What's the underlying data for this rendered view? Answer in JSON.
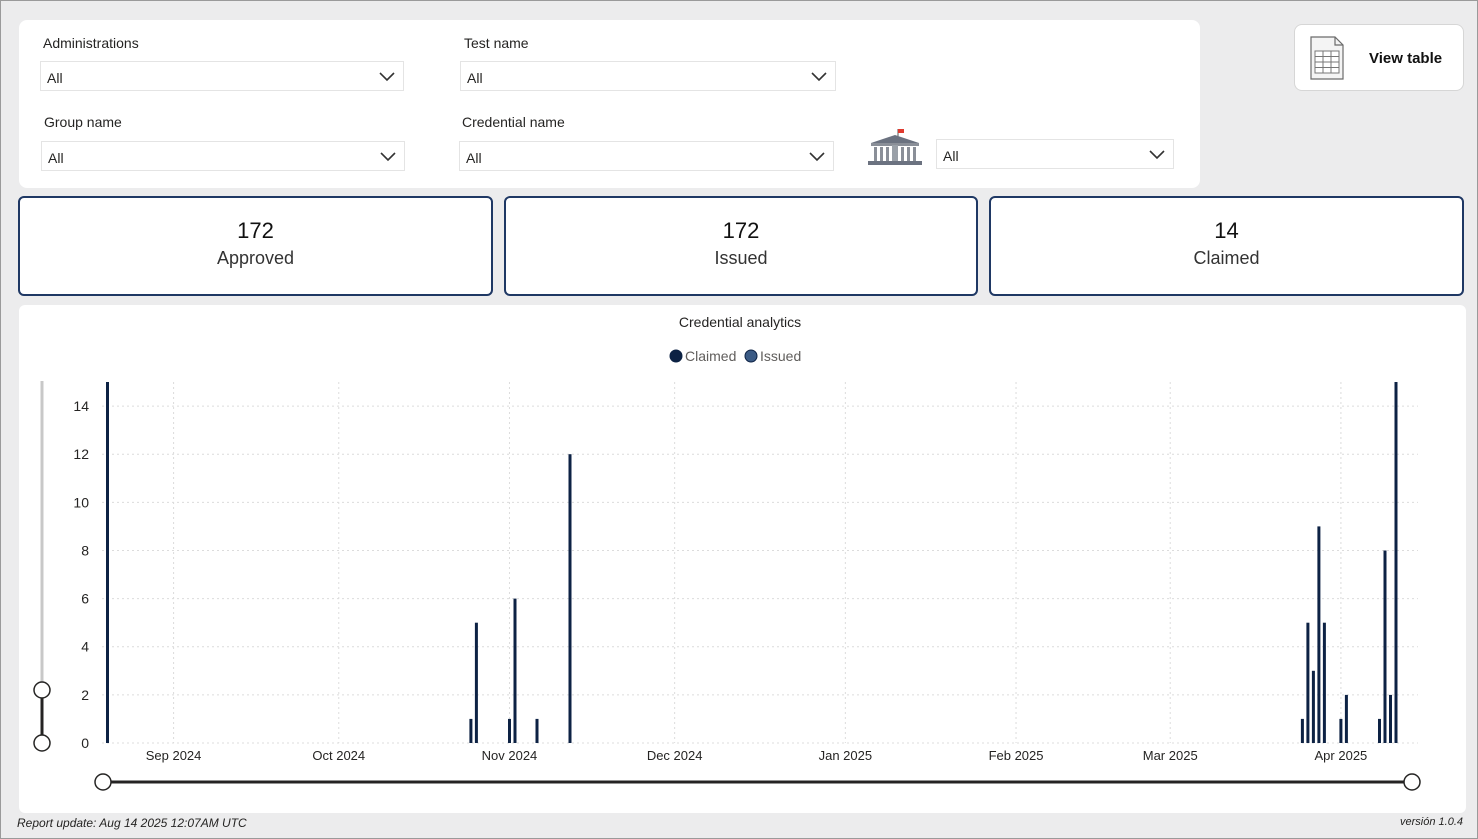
{
  "filters": {
    "administrations": {
      "label": "Administrations",
      "value": "All"
    },
    "test_name": {
      "label": "Test name",
      "value": "All"
    },
    "group_name": {
      "label": "Group name",
      "value": "All"
    },
    "credential_name": {
      "label": "Credential name",
      "value": "All"
    },
    "institution": {
      "icon": "institution-building-icon",
      "value": "All"
    }
  },
  "view_table": {
    "label": "View table",
    "icon": "table-sheet-icon"
  },
  "kpis": [
    {
      "value": "172",
      "label": "Approved"
    },
    {
      "value": "172",
      "label": "Issued"
    },
    {
      "value": "14",
      "label": "Claimed"
    }
  ],
  "footer": {
    "report_update": "Report update: Aug 14 2025 12:07AM UTC",
    "version": "versión 1.0.4"
  },
  "colors": {
    "claimed": "#0d2244",
    "issued": "#3b5b85",
    "card_border": "#1f3864"
  },
  "chart_data": {
    "type": "bar",
    "title": "Credential analytics",
    "legend": [
      "Claimed",
      "Issued"
    ],
    "legend_position": "top-center",
    "grid": true,
    "xlim": [
      "2024-08-19",
      "2025-04-15"
    ],
    "ylim": [
      0,
      15
    ],
    "yticks": [
      0,
      2,
      4,
      6,
      8,
      10,
      12,
      14
    ],
    "xticks": [
      {
        "date": "2024-09-01",
        "label": "Sep 2024"
      },
      {
        "date": "2024-10-01",
        "label": "Oct 2024"
      },
      {
        "date": "2024-11-01",
        "label": "Nov 2024"
      },
      {
        "date": "2024-12-01",
        "label": "Dec 2024"
      },
      {
        "date": "2025-01-01",
        "label": "Jan 2025"
      },
      {
        "date": "2025-02-01",
        "label": "Feb 2025"
      },
      {
        "date": "2025-03-01",
        "label": "Mar 2025"
      },
      {
        "date": "2025-04-01",
        "label": "Apr 2025"
      }
    ],
    "series": [
      {
        "name": "Claimed",
        "points": [
          {
            "x": "2024-08-20",
            "y": 1
          },
          {
            "x": "2024-10-25",
            "y": 1
          },
          {
            "x": "2024-11-01",
            "y": 1
          },
          {
            "x": "2024-11-06",
            "y": 1
          },
          {
            "x": "2025-03-25",
            "y": 1
          },
          {
            "x": "2025-04-01",
            "y": 1
          },
          {
            "x": "2025-04-08",
            "y": 1
          }
        ]
      },
      {
        "name": "Issued",
        "points": [
          {
            "x": "2024-08-20",
            "y": 15
          },
          {
            "x": "2024-10-26",
            "y": 5
          },
          {
            "x": "2024-11-02",
            "y": 6
          },
          {
            "x": "2024-11-12",
            "y": 12
          },
          {
            "x": "2025-03-26",
            "y": 5
          },
          {
            "x": "2025-03-27",
            "y": 3
          },
          {
            "x": "2025-03-28",
            "y": 9
          },
          {
            "x": "2025-03-29",
            "y": 5
          },
          {
            "x": "2025-04-02",
            "y": 2
          },
          {
            "x": "2025-04-09",
            "y": 8
          },
          {
            "x": "2025-04-10",
            "y": 2
          },
          {
            "x": "2025-04-11",
            "y": 15
          }
        ]
      }
    ]
  }
}
